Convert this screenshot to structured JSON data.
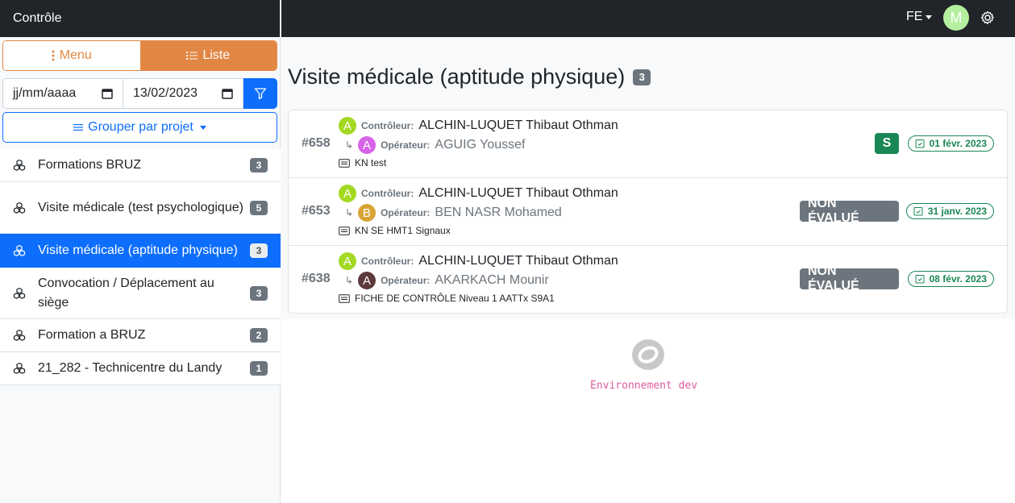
{
  "sidebar": {
    "title": "Contrôle",
    "modes": [
      {
        "label": "Menu",
        "icon": "vertical-dots-icon",
        "active": false
      },
      {
        "label": "Liste",
        "icon": "list-icon",
        "active": true
      }
    ],
    "date_from": {
      "value": "jj/mm/aaaa"
    },
    "date_to": {
      "value": "13/02/2023"
    },
    "group_button": "Grouper par projet",
    "projects": [
      {
        "label": "Formations BRUZ",
        "count": "3"
      },
      {
        "label": "Visite médicale (test psychologique)",
        "count": "5"
      },
      {
        "label": "Visite médicale (aptitude physique)",
        "count": "3",
        "active": true
      },
      {
        "label": "Convocation / Déplacement au siège",
        "count": "3"
      },
      {
        "label": "Formation a BRUZ",
        "count": "2"
      },
      {
        "label": "21_282 - Technicentre du Landy",
        "count": "1"
      }
    ]
  },
  "topbar": {
    "lang": "FE",
    "user_initial": "M"
  },
  "main": {
    "title": "Visite médicale (aptitude physique)",
    "count": "3",
    "controls": [
      {
        "id": "#658",
        "controller_role": "Contrôleur:",
        "controller_initial": "A",
        "controller_name": "ALCHIN-LUQUET Thibaut Othman",
        "operator_role": "Opérateur:",
        "operator_initial": "A",
        "operator_color": "#d763e8",
        "operator_name": "AGUIG Youssef",
        "form": "KN test",
        "status": "S",
        "status_color": "#198754",
        "date": "01 févr. 2023"
      },
      {
        "id": "#653",
        "controller_role": "Contrôleur:",
        "controller_initial": "A",
        "controller_name": "ALCHIN-LUQUET Thibaut Othman",
        "operator_role": "Opérateur:",
        "operator_initial": "B",
        "operator_color": "#d9a436",
        "operator_name": "BEN NASR Mohamed",
        "form": "KN SE HMT1 Signaux",
        "status": "NON ÉVALUÉ",
        "status_color": "#6c757d",
        "date": "31 janv. 2023"
      },
      {
        "id": "#638",
        "controller_role": "Contrôleur:",
        "controller_initial": "A",
        "controller_name": "ALCHIN-LUQUET Thibaut Othman",
        "operator_role": "Opérateur:",
        "operator_initial": "A",
        "operator_color": "#5c3a3a",
        "operator_name": "AKARKACH Mounir",
        "form": "FICHE DE CONTRÔLE Niveau 1 AATTx S9A1",
        "status": "NON ÉVALUÉ",
        "status_color": "#6c757d",
        "date": "08 févr. 2023"
      }
    ],
    "controller_color": "#a3d921",
    "env_label": "Environnement dev"
  }
}
